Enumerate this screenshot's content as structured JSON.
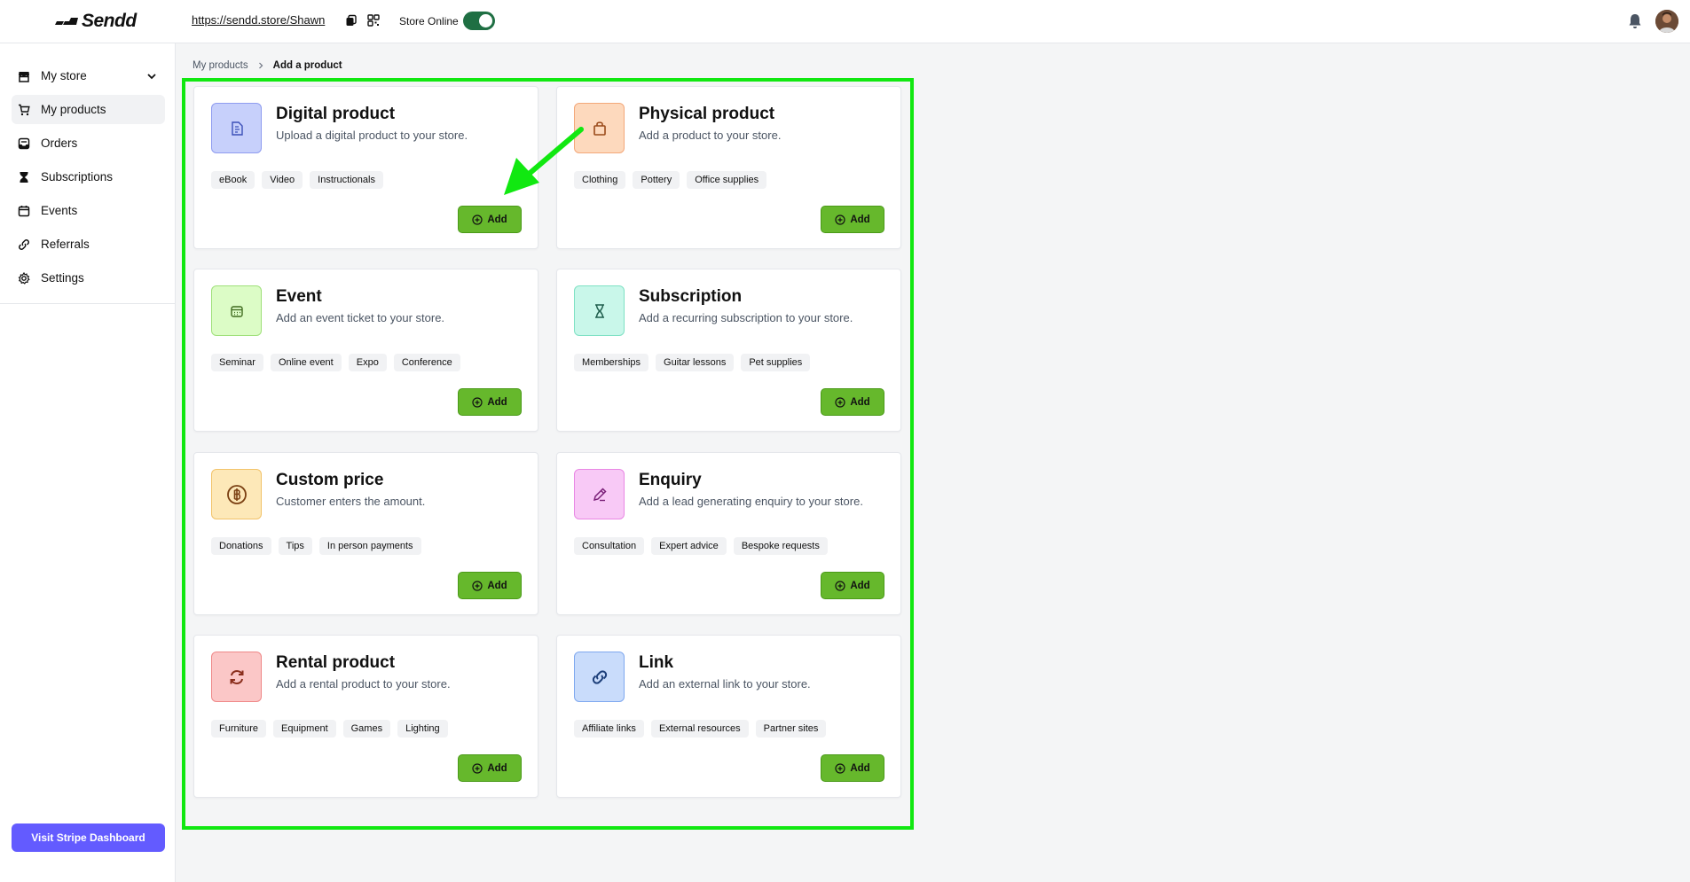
{
  "header": {
    "logo_text": "Sendd",
    "store_url": "https://sendd.store/Shawn",
    "store_online_label": "Store Online",
    "store_online": true
  },
  "sidebar": {
    "items": [
      {
        "label": "My store",
        "icon": "store-icon"
      },
      {
        "label": "My products",
        "icon": "cart-icon"
      },
      {
        "label": "Orders",
        "icon": "inbox-icon"
      },
      {
        "label": "Subscriptions",
        "icon": "hourglass-icon"
      },
      {
        "label": "Events",
        "icon": "calendar-icon"
      },
      {
        "label": "Referrals",
        "icon": "link-icon"
      },
      {
        "label": "Settings",
        "icon": "gear-icon"
      }
    ],
    "stripe_button": "Visit Stripe Dashboard"
  },
  "breadcrumb": {
    "parent": "My products",
    "current": "Add a product"
  },
  "add_label": "Add",
  "cards": [
    {
      "title": "Digital product",
      "desc": "Upload a digital product to your store.",
      "tags": [
        "eBook",
        "Video",
        "Instructionals"
      ],
      "icon": "document-icon",
      "color": "#c7d0fb",
      "border": "#8f9cf0"
    },
    {
      "title": "Physical product",
      "desc": "Add a product to your store.",
      "tags": [
        "Clothing",
        "Pottery",
        "Office supplies"
      ],
      "icon": "bag-icon",
      "color": "#fdd9bd",
      "border": "#f3a87a"
    },
    {
      "title": "Event",
      "desc": "Add an event ticket to your store.",
      "tags": [
        "Seminar",
        "Online event",
        "Expo",
        "Conference"
      ],
      "icon": "calendar-icon",
      "color": "#dcfcc6",
      "border": "#9fe07a"
    },
    {
      "title": "Subscription",
      "desc": "Add a recurring subscription to your store.",
      "tags": [
        "Memberships",
        "Guitar lessons",
        "Pet supplies"
      ],
      "icon": "hourglass-icon",
      "color": "#c9f7ea",
      "border": "#7fe1c4"
    },
    {
      "title": "Custom price",
      "desc": "Customer enters the amount.",
      "tags": [
        "Donations",
        "Tips",
        "In person payments"
      ],
      "icon": "coin-icon",
      "color": "#fde8b8",
      "border": "#f2c36a"
    },
    {
      "title": "Enquiry",
      "desc": "Add a lead generating enquiry to your store.",
      "tags": [
        "Consultation",
        "Expert advice",
        "Bespoke requests"
      ],
      "icon": "pencil-icon",
      "color": "#f8c9f6",
      "border": "#e987e4"
    },
    {
      "title": "Rental product",
      "desc": "Add a rental product to your store.",
      "tags": [
        "Furniture",
        "Equipment",
        "Games",
        "Lighting"
      ],
      "icon": "refresh-icon",
      "color": "#fbc7c7",
      "border": "#ef8888"
    },
    {
      "title": "Link",
      "desc": "Add an external link to your store.",
      "tags": [
        "Affiliate links",
        "External resources",
        "Partner sites"
      ],
      "icon": "chain-link-icon",
      "color": "#c9dcfb",
      "border": "#7fa8ef"
    }
  ]
}
